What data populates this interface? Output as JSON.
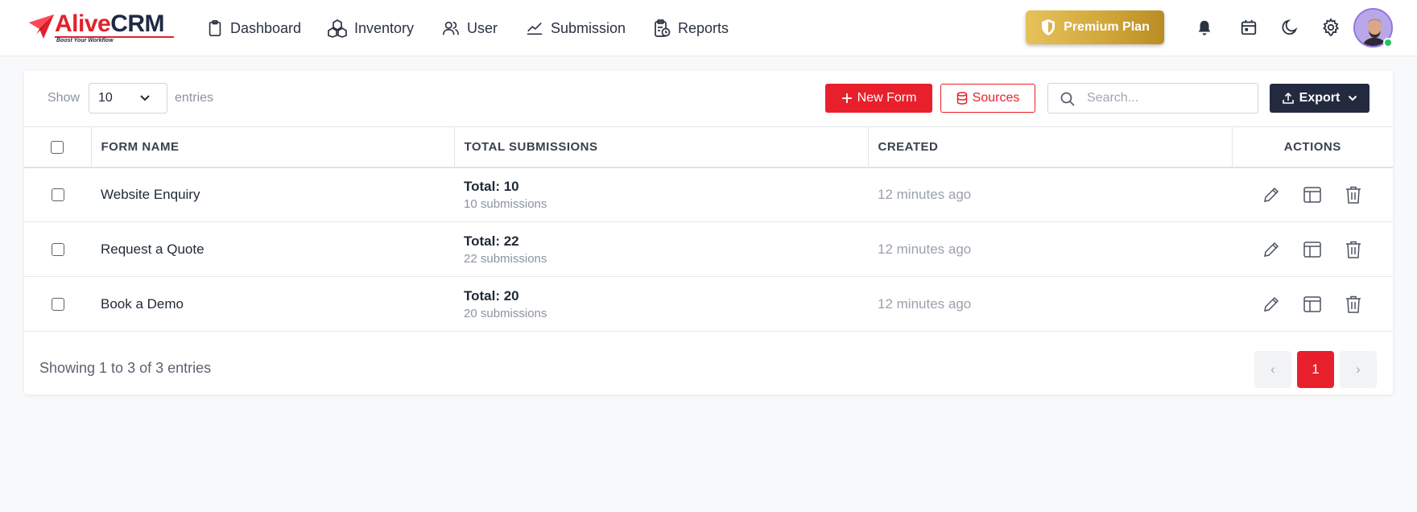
{
  "app": {
    "logo_a": "Alive",
    "logo_b": "CRM",
    "logo_tagline": "Boost Your Workflow"
  },
  "nav": [
    {
      "label": "Dashboard",
      "icon": "clipboard-icon"
    },
    {
      "label": "Inventory",
      "icon": "boxes-icon"
    },
    {
      "label": "User",
      "icon": "users-icon"
    },
    {
      "label": "Submission",
      "icon": "chart-line-icon"
    },
    {
      "label": "Reports",
      "icon": "report-icon"
    }
  ],
  "premium": {
    "label": "Premium Plan",
    "icon": "shield-icon"
  },
  "toolbar_icons": [
    "bell-icon",
    "calendar-icon",
    "moon-icon",
    "gear-icon"
  ],
  "controls": {
    "show_label": "Show",
    "entries_value": "10",
    "entries_label": "entries",
    "new_form_label": "New Form",
    "sources_label": "Sources",
    "search_placeholder": "Search...",
    "export_label": "Export"
  },
  "table": {
    "headers": [
      "FORM NAME",
      "TOTAL SUBMISSIONS",
      "CREATED",
      "ACTIONS"
    ],
    "rows": [
      {
        "name": "Website Enquiry",
        "total": "Total: 10",
        "subs": "10 submissions",
        "created": "12 minutes ago"
      },
      {
        "name": "Request a Quote",
        "total": "Total: 22",
        "subs": "22 submissions",
        "created": "12 minutes ago"
      },
      {
        "name": "Book a Demo",
        "total": "Total: 20",
        "subs": "20 submissions",
        "created": "12 minutes ago"
      }
    ]
  },
  "footer": {
    "showing": "Showing 1 to 3 of 3 entries",
    "prev": "‹",
    "page": "1",
    "next": "›"
  },
  "colors": {
    "accent": "#e8202b",
    "dark": "#232a40",
    "gold": "#d2a83c",
    "online": "#22c55e"
  }
}
